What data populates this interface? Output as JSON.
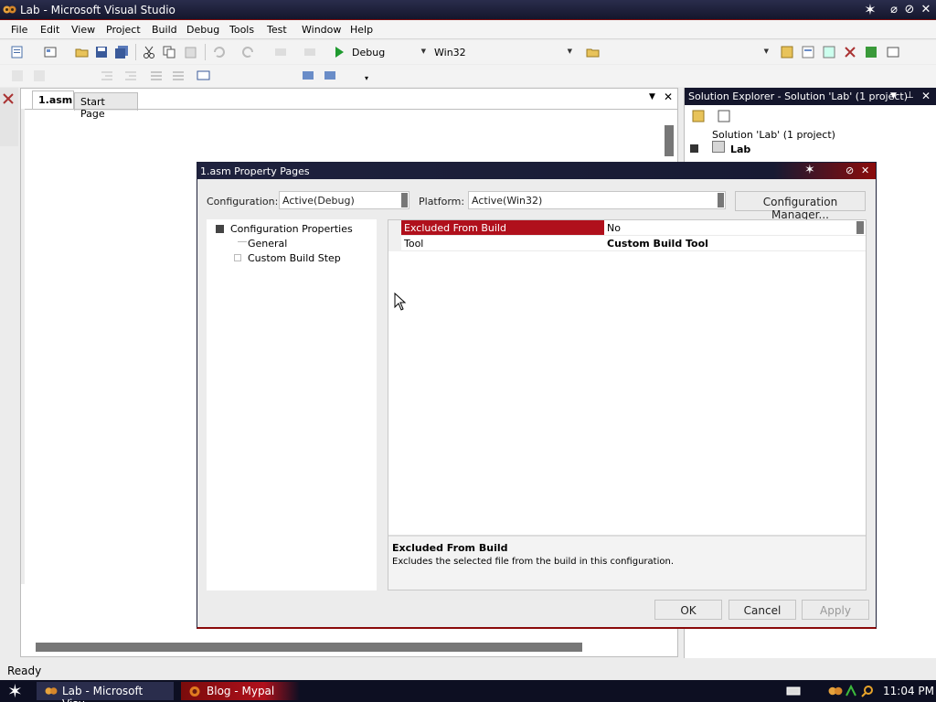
{
  "window": {
    "title": "Lab - Microsoft Visual Studio"
  },
  "menu": [
    "File",
    "Edit",
    "View",
    "Project",
    "Build",
    "Debug",
    "Tools",
    "Test",
    "Window",
    "Help"
  ],
  "toolbar": {
    "config": "Debug",
    "platform": "Win32"
  },
  "editor": {
    "tabs": [
      {
        "label": "1.asm",
        "active": true
      },
      {
        "label": "Start Page",
        "active": false
      }
    ]
  },
  "solution_explorer": {
    "title": "Solution Explorer - Solution 'Lab' (1 project)",
    "items": [
      "Solution 'Lab' (1 project)",
      "Lab"
    ]
  },
  "dialog": {
    "title": "1.asm Property Pages",
    "configuration_label": "Configuration:",
    "configuration_value": "Active(Debug)",
    "platform_label": "Platform:",
    "platform_value": "Active(Win32)",
    "config_manager_label": "Configuration Manager...",
    "tree": {
      "root": "Configuration Properties",
      "children": [
        "General",
        "Custom Build Step"
      ]
    },
    "properties": [
      {
        "name": "Excluded From Build",
        "value": "No",
        "selected": true
      },
      {
        "name": "Tool",
        "value": "Custom Build Tool",
        "selected": false
      }
    ],
    "description": {
      "title": "Excluded From Build",
      "text": "Excludes the selected file from the build in this configuration."
    },
    "buttons": {
      "ok": "OK",
      "cancel": "Cancel",
      "apply": "Apply"
    }
  },
  "status": {
    "text": "Ready"
  },
  "taskbar": {
    "tasks": [
      "Lab - Microsoft Visu...",
      "Blog - Mypal"
    ],
    "clock": "11:04 PM"
  },
  "colors": {
    "accent_red": "#b0101c",
    "title_dark": "#14162c"
  }
}
